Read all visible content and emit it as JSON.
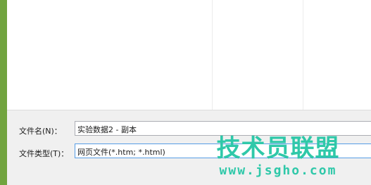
{
  "colors": {
    "accent_strip": "#71a43f",
    "pane_bg": "#ffffff",
    "dialog_bg": "#f0f0f0",
    "watermark": "#2fc8a9"
  },
  "save_dialog": {
    "filename_label": "文件名(N)：",
    "filename_value": "实验数据2 - 副本",
    "filetype_label": "文件类型(T)：",
    "filetype_value": "网页文件(*.htm; *.html)"
  },
  "watermark": {
    "title": "技术员联盟",
    "url": "www.jsgho.com"
  }
}
